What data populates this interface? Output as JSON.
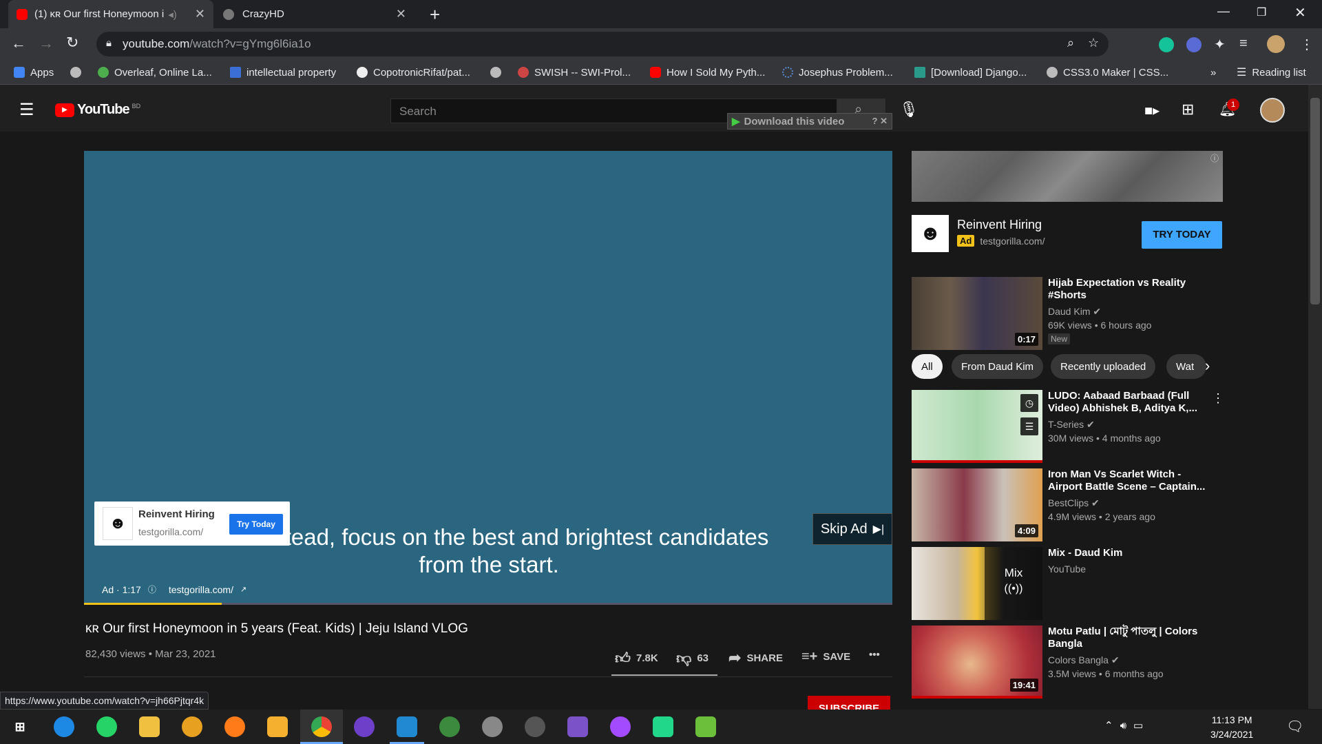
{
  "browser": {
    "tabs": [
      {
        "title": "(1) ᴋʀ Our first Honeymoon i",
        "active": true
      },
      {
        "title": "CrazyHD",
        "active": false
      }
    ],
    "url_domain": "youtube.com",
    "url_path": "/watch?v=gYmg6l6ia1o",
    "bookmarks": [
      "Apps",
      "Overleaf, Online La...",
      "intellectual property",
      "CopotronicRifat/pat...",
      "SWISH -- SWI-Prol...",
      "How I Sold My Pyth...",
      "Josephus Problem...",
      "[Download] Django...",
      "CSS3.0 Maker | CSS..."
    ],
    "bookmarks_more": "»",
    "reading_list": "Reading list",
    "status_url": "https://www.youtube.com/watch?v=jh66Pjtqr4k"
  },
  "yt": {
    "logo_text": "YouTube",
    "country": "BD",
    "search_placeholder": "Search",
    "download_banner": "Download this video",
    "notification_count": "1"
  },
  "player": {
    "caption_line1": "And instead, focus on the best and brightest candidates",
    "caption_line2": "from the start.",
    "ad_card_title": "Reinvent Hiring",
    "ad_card_domain": "testgorilla.com/",
    "ad_card_button": "Try Today",
    "skip_label": "Skip Ad",
    "ad_time": "Ad · 1:17",
    "ad_domain": "testgorilla.com/",
    "ad_progress": 0.17
  },
  "video": {
    "title": "ᴋʀ Our first Honeymoon in 5 years (Feat. Kids) | Jeju Island VLOG",
    "stats": "82,430 views • Mar 23, 2021",
    "likes": "7.8K",
    "dislikes": "63",
    "share_label": "SHARE",
    "save_label": "SAVE",
    "subscribe_label": "SUBSCRIBE"
  },
  "sidebar": {
    "ad": {
      "title": "Reinvent Hiring",
      "badge": "Ad",
      "domain": "testgorilla.com/",
      "button": "TRY TODAY"
    },
    "first_video": {
      "title": "Hijab Expectation vs Reality #Shorts",
      "channel": "Daud Kim",
      "meta": "69K views • 6 hours ago",
      "badge": "New",
      "duration": "0:17"
    },
    "chips": [
      "All",
      "From Daud Kim",
      "Recently uploaded",
      "Wat"
    ],
    "videos": [
      {
        "title": "LUDO: Aabaad Barbaad (Full Video) Abhishek B, Aditya K,...",
        "channel": "T-Series",
        "meta": "30M views • 4 months ago",
        "duration": ""
      },
      {
        "title": "Iron Man Vs Scarlet Witch - Airport Battle Scene – Captain...",
        "channel": "BestClips",
        "meta": "4.9M views • 2 years ago",
        "duration": "4:09"
      },
      {
        "title": "Mix - Daud Kim",
        "channel": "YouTube",
        "meta": "",
        "duration": ""
      },
      {
        "title": "Motu Patlu | মোটু পাতলু | Colors Bangla",
        "channel": "Colors Bangla",
        "meta": "3.5M views • 6 months ago",
        "duration": "19:41"
      }
    ],
    "mix_label": "Mix"
  },
  "taskbar": {
    "time": "11:13 PM",
    "date": "3/24/2021"
  },
  "colors": {
    "player_bg": "#2a6680",
    "ad_yellow": "#f2c21b",
    "try_blue": "#065fd4",
    "subscribe_red": "#cc0000"
  }
}
